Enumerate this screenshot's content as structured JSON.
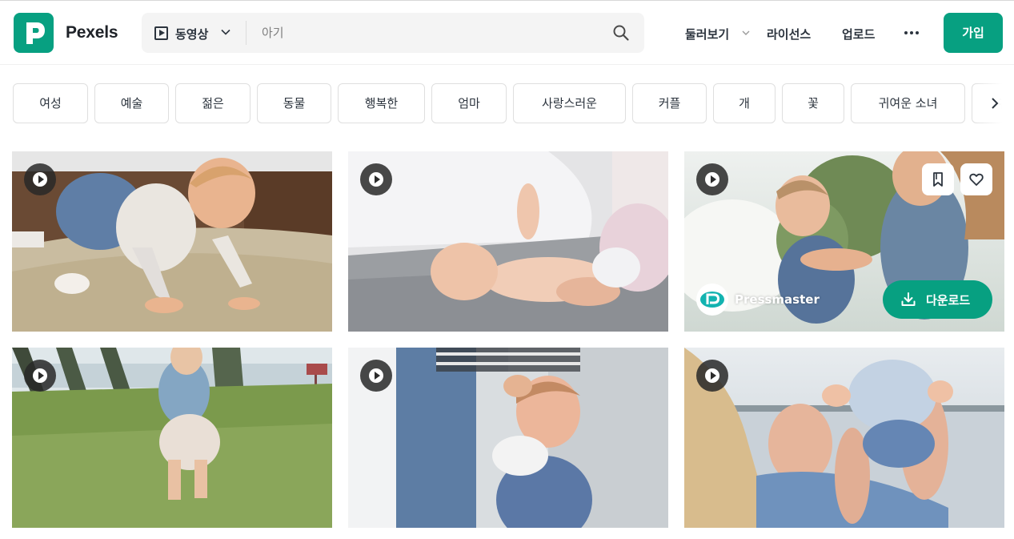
{
  "brand": {
    "name": "Pexels",
    "accent_color": "#07a081"
  },
  "search": {
    "type_label": "동영상",
    "placeholder": "아기"
  },
  "nav": {
    "explore": "둘러보기",
    "license": "라이선스",
    "upload": "업로드",
    "join": "가입"
  },
  "tags": [
    "여성",
    "예술",
    "젊은",
    "동물",
    "행복한",
    "엄마",
    "사랑스러운",
    "커플",
    "개",
    "꽃",
    "귀여운 소녀"
  ],
  "tags_next_partial": "귀",
  "videos": [
    {
      "scene": "baby crawling on carpet",
      "icon": "play-icon"
    },
    {
      "scene": "baby lying on bed",
      "icon": "play-icon"
    },
    {
      "scene": "mother holding baby outdoors",
      "icon": "play-icon",
      "author": "Pressmaster",
      "download_label": "다운로드"
    },
    {
      "scene": "toddler walking on grass",
      "icon": "play-icon"
    },
    {
      "scene": "baby standing with parent",
      "icon": "play-icon"
    },
    {
      "scene": "woman lifting baby by lake",
      "icon": "play-icon"
    }
  ]
}
